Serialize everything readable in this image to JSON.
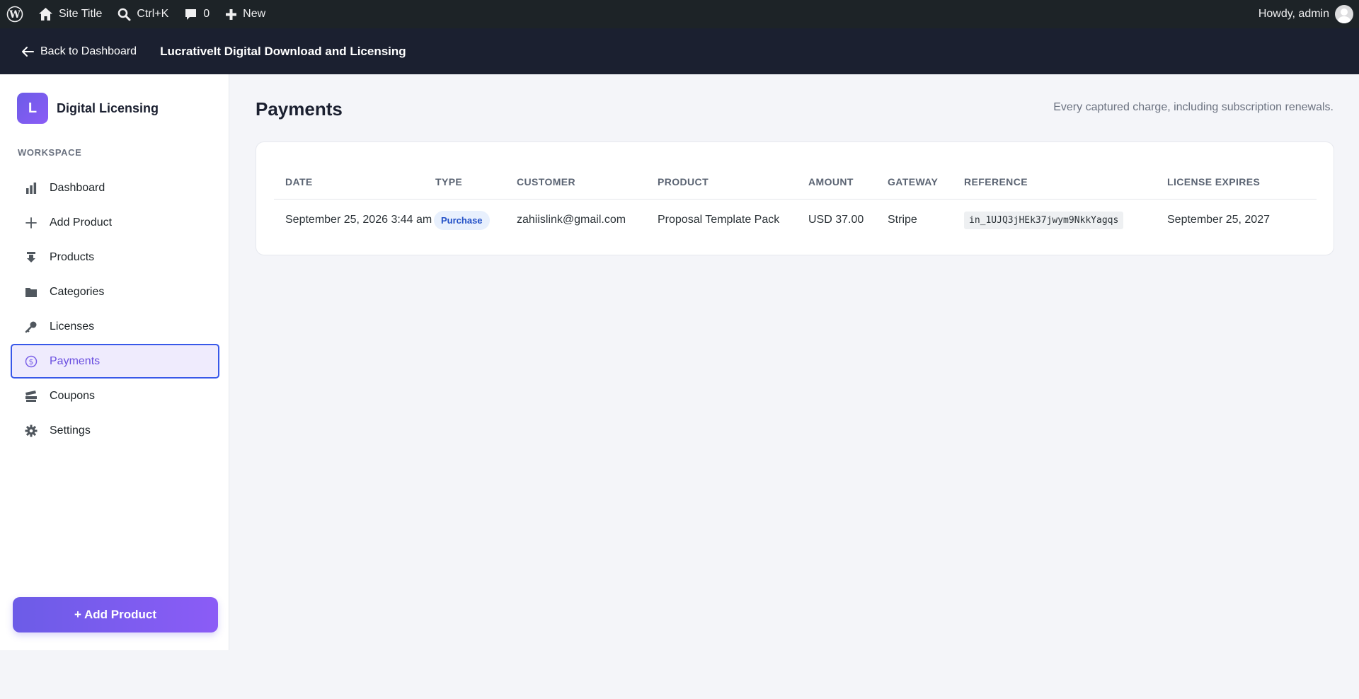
{
  "adminbar": {
    "site_title": "Site Title",
    "search_label": "Ctrl+K",
    "comments_count": "0",
    "new_label": "New",
    "howdy": "Howdy, admin"
  },
  "plugin_header": {
    "back_label": "Back to Dashboard",
    "title": "LucrativeIt Digital Download and Licensing"
  },
  "sidebar": {
    "brand_initial": "L",
    "brand_name": "Digital Licensing",
    "section_label": "WORKSPACE",
    "items": [
      {
        "label": "Dashboard",
        "icon": "bar-chart-icon"
      },
      {
        "label": "Add Product",
        "icon": "plus-icon"
      },
      {
        "label": "Products",
        "icon": "download-icon"
      },
      {
        "label": "Categories",
        "icon": "folder-icon"
      },
      {
        "label": "Licenses",
        "icon": "key-icon"
      },
      {
        "label": "Payments",
        "icon": "dollar-circle-icon",
        "active": true
      },
      {
        "label": "Coupons",
        "icon": "tickets-icon"
      },
      {
        "label": "Settings",
        "icon": "gear-icon"
      }
    ],
    "add_button_label": "+ Add Product"
  },
  "main": {
    "title": "Payments",
    "subtitle": "Every captured charge, including subscription renewals."
  },
  "table": {
    "headers": [
      "DATE",
      "TYPE",
      "CUSTOMER",
      "PRODUCT",
      "AMOUNT",
      "GATEWAY",
      "REFERENCE",
      "LICENSE EXPIRES"
    ],
    "rows": [
      {
        "date": "September 25, 2026 3:44 am",
        "type": "Purchase",
        "customer": "zahiislink@gmail.com",
        "product": "Proposal Template Pack",
        "amount": "USD 37.00",
        "gateway": "Stripe",
        "reference": "in_1UJQ3jHEk37jwym9NkkYagqs",
        "license_expires": "September 25, 2027"
      }
    ]
  },
  "colors": {
    "accent": "#6c5ce7",
    "active_border": "#3858e9",
    "admin_bar": "#1d2327",
    "plugin_header": "#1b2030"
  }
}
